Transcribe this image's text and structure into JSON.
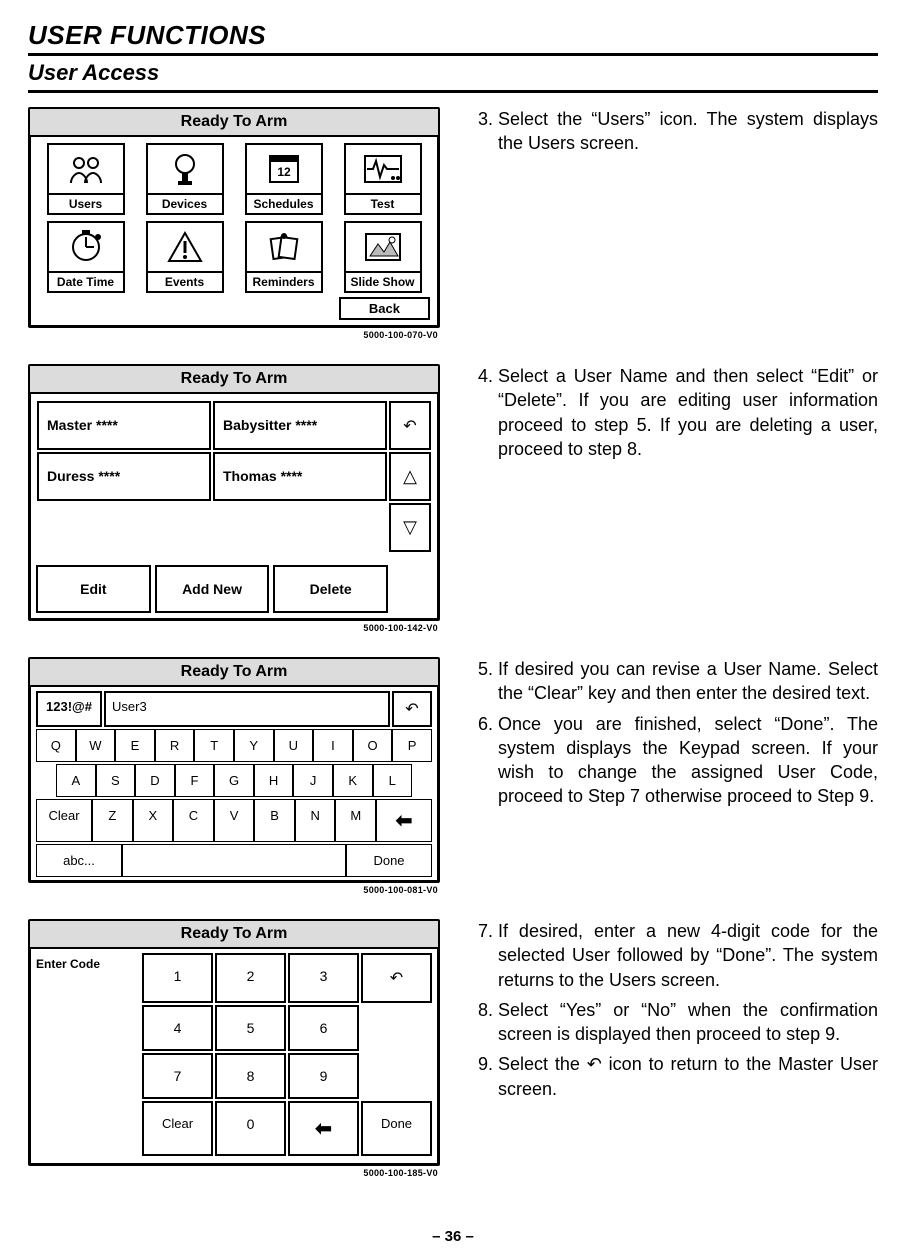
{
  "page": {
    "title1": "USER FUNCTIONS",
    "title2": "User Access",
    "footer": "– 36 –"
  },
  "panel1": {
    "title": "Ready To Arm",
    "icons_row1": [
      "Users",
      "Devices",
      "Schedules",
      "Test"
    ],
    "icons_row2": [
      "Date Time",
      "Events",
      "Reminders",
      "Slide Show"
    ],
    "back": "Back",
    "code": "5000-100-070-V0"
  },
  "panel2": {
    "title": "Ready To Arm",
    "users": [
      "Master ****",
      "Babysitter ****",
      "Duress ****",
      "Thomas ****"
    ],
    "actions": [
      "Edit",
      "Add New",
      "Delete"
    ],
    "code": "5000-100-142-V0"
  },
  "panel3": {
    "title": "Ready To Arm",
    "mode": "123!@#",
    "input": "User3",
    "row1": [
      "Q",
      "W",
      "E",
      "R",
      "T",
      "Y",
      "U",
      "I",
      "O",
      "P"
    ],
    "row2": [
      "A",
      "S",
      "D",
      "F",
      "G",
      "H",
      "J",
      "K",
      "L"
    ],
    "row3": [
      "Z",
      "X",
      "C",
      "V",
      "B",
      "N",
      "M"
    ],
    "clear": "Clear",
    "abc": "abc...",
    "done": "Done",
    "code": "5000-100-081-V0"
  },
  "panel4": {
    "title": "Ready To Arm",
    "prompt": "Enter Code",
    "clear": "Clear",
    "done": "Done",
    "code": "5000-100-185-V0"
  },
  "steps": {
    "s3": "Select the “Users” icon. The system displays the Users screen.",
    "s4": "Select a User Name and then select “Edit” or “Delete”. If you are editing user information proceed to step 5. If you are deleting a user, proceed to step 8.",
    "s5": "If desired you can revise a User Name. Select the “Clear” key and then enter the desired text.",
    "s6": "Once you are finished, select “Done”. The system displays the Keypad screen. If your wish to change the assigned User Code, proceed to Step 7 otherwise proceed to Step 9.",
    "s7": "If desired, enter a new 4-digit code for the selected User followed by “Done”. The system returns to the Users screen.",
    "s8": "Select “Yes” or “No” when the confirmation screen is displayed then proceed to step 9.",
    "s9": "Select the  ↶  icon to return to the Master User screen."
  }
}
